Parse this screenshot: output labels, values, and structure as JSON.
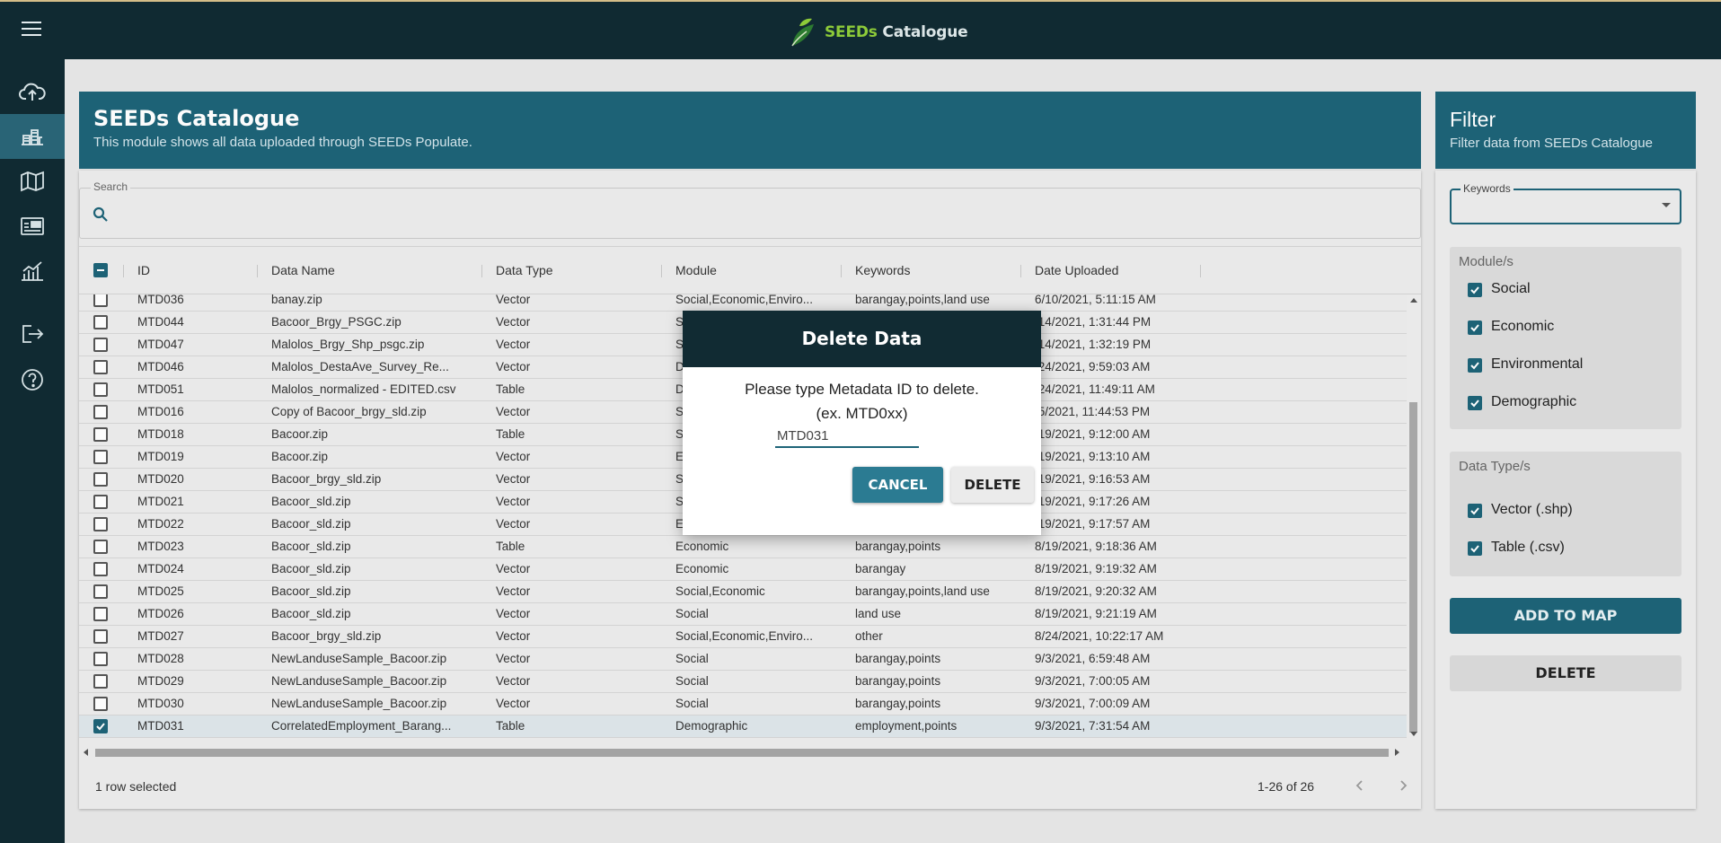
{
  "app": {
    "brand_prefix": "SEEDs",
    "brand_suffix": " Catalogue",
    "icons": [
      "menu-icon",
      "leaf-logo-icon"
    ]
  },
  "sidebar": {
    "items": [
      {
        "icon": "cloud-upload-icon"
      },
      {
        "icon": "catalogue-icon",
        "active": true
      },
      {
        "icon": "map-icon"
      },
      {
        "icon": "dashboard-icon"
      },
      {
        "icon": "chart-icon"
      },
      {
        "icon": "logout-icon"
      },
      {
        "icon": "help-icon"
      }
    ]
  },
  "main": {
    "title": "SEEDs Catalogue",
    "subtitle": "This module shows all data uploaded through SEEDs Populate.",
    "search_label": "Search",
    "columns": [
      "ID",
      "Data Name",
      "Data Type",
      "Module",
      "Keywords",
      "Date Uploaded"
    ],
    "rows": [
      {
        "id": "MTD036",
        "name": "banay.zip",
        "type": "Vector",
        "module": "Social,Economic,Enviro...",
        "keywords": "barangay,points,land use",
        "date": "6/10/2021, 5:11:15 AM"
      },
      {
        "id": "MTD044",
        "name": "Bacoor_Brgy_PSGC.zip",
        "type": "Vector",
        "module": "S",
        "keywords": "",
        "date": "/14/2021, 1:31:44 PM"
      },
      {
        "id": "MTD047",
        "name": "Malolos_Brgy_Shp_psgc.zip",
        "type": "Vector",
        "module": "S",
        "keywords": "",
        "date": "/14/2021, 1:32:19 PM"
      },
      {
        "id": "MTD046",
        "name": "Malolos_DestaAve_Survey_Re...",
        "type": "Vector",
        "module": "D",
        "keywords": "",
        "date": "/24/2021, 9:59:03 AM"
      },
      {
        "id": "MTD051",
        "name": "Malolos_normalized - EDITED.csv",
        "type": "Table",
        "module": "D",
        "keywords": "",
        "date": "/24/2021, 11:49:11 AM"
      },
      {
        "id": "MTD016",
        "name": "Copy of Bacoor_brgy_sld.zip",
        "type": "Vector",
        "module": "S",
        "keywords": "",
        "date": "/5/2021, 11:44:53 PM"
      },
      {
        "id": "MTD018",
        "name": "Bacoor.zip",
        "type": "Table",
        "module": "S",
        "keywords": "",
        "date": "/19/2021, 9:12:00 AM"
      },
      {
        "id": "MTD019",
        "name": "Bacoor.zip",
        "type": "Vector",
        "module": "E",
        "keywords": "",
        "date": "/19/2021, 9:13:10 AM"
      },
      {
        "id": "MTD020",
        "name": "Bacoor_brgy_sld.zip",
        "type": "Vector",
        "module": "S",
        "keywords": "",
        "date": "/19/2021, 9:16:53 AM"
      },
      {
        "id": "MTD021",
        "name": "Bacoor_sld.zip",
        "type": "Vector",
        "module": "S",
        "keywords": "",
        "date": "/19/2021, 9:17:26 AM"
      },
      {
        "id": "MTD022",
        "name": "Bacoor_sld.zip",
        "type": "Vector",
        "module": "E",
        "keywords": "",
        "date": "/19/2021, 9:17:57 AM"
      },
      {
        "id": "MTD023",
        "name": "Bacoor_sld.zip",
        "type": "Table",
        "module": "Economic",
        "keywords": "barangay,points",
        "date": "8/19/2021, 9:18:36 AM"
      },
      {
        "id": "MTD024",
        "name": "Bacoor_sld.zip",
        "type": "Vector",
        "module": "Economic",
        "keywords": "barangay",
        "date": "8/19/2021, 9:19:32 AM"
      },
      {
        "id": "MTD025",
        "name": "Bacoor_sld.zip",
        "type": "Vector",
        "module": "Social,Economic",
        "keywords": "barangay,points,land use",
        "date": "8/19/2021, 9:20:32 AM"
      },
      {
        "id": "MTD026",
        "name": "Bacoor_sld.zip",
        "type": "Vector",
        "module": "Social",
        "keywords": "land use",
        "date": "8/19/2021, 9:21:19 AM"
      },
      {
        "id": "MTD027",
        "name": "Bacoor_brgy_sld.zip",
        "type": "Vector",
        "module": "Social,Economic,Enviro...",
        "keywords": "other",
        "date": "8/24/2021, 10:22:17 AM"
      },
      {
        "id": "MTD028",
        "name": "NewLanduseSample_Bacoor.zip",
        "type": "Vector",
        "module": "Social",
        "keywords": "barangay,points",
        "date": "9/3/2021, 6:59:48 AM"
      },
      {
        "id": "MTD029",
        "name": "NewLanduseSample_Bacoor.zip",
        "type": "Vector",
        "module": "Social",
        "keywords": "barangay,points",
        "date": "9/3/2021, 7:00:05 AM"
      },
      {
        "id": "MTD030",
        "name": "NewLanduseSample_Bacoor.zip",
        "type": "Vector",
        "module": "Social",
        "keywords": "barangay,points",
        "date": "9/3/2021, 7:00:09 AM"
      },
      {
        "id": "MTD031",
        "name": "CorrelatedEmployment_Barang...",
        "type": "Table",
        "module": "Demographic",
        "keywords": "employment,points",
        "date": "9/3/2021, 7:31:54 AM",
        "selected": true
      }
    ],
    "footer_selected": "1 row selected",
    "pagination": "1-26 of 26"
  },
  "filter": {
    "title": "Filter",
    "subtitle": "Filter data from SEEDs Catalogue",
    "keywords_label": "Keywords",
    "module_title": "Module/s",
    "modules": [
      "Social",
      "Economic",
      "Environmental",
      "Demographic"
    ],
    "datatype_title": "Data Type/s",
    "datatypes": [
      "Vector (.shp)",
      "Table (.csv)"
    ],
    "add_to_map": "ADD TO MAP",
    "delete": "DELETE"
  },
  "modal": {
    "title": "Delete Data",
    "line1": "Please type Metadata ID to delete.",
    "line2": "(ex. MTD0xx)",
    "input_value": "MTD031",
    "cancel": "CANCEL",
    "delete": "DELETE"
  },
  "colors": {
    "header": "#112b33",
    "accent": "#1e6478",
    "brand_green": "#8fce3a"
  }
}
